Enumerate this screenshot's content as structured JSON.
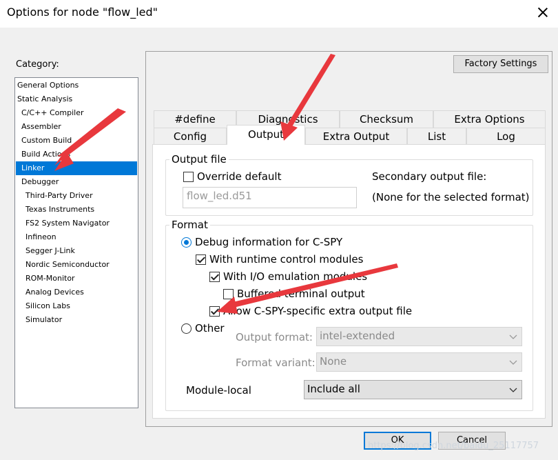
{
  "window": {
    "title": "Options for node \"flow_led\"",
    "close_icon": "close-icon"
  },
  "category": {
    "label": "Category:",
    "items": [
      "General Options",
      "Static Analysis",
      "C/C++ Compiler",
      "Assembler",
      "Custom Build",
      "Build Actions",
      "Linker",
      "Debugger",
      "Third-Party Driver",
      "Texas Instruments",
      "FS2 System Navigator",
      "Infineon",
      "Segger J-Link",
      "Nordic Semiconductor",
      "ROM-Monitor",
      "Analog Devices",
      "Silicon Labs",
      "Simulator"
    ],
    "selected": "Linker"
  },
  "factory_settings_label": "Factory Settings",
  "tabs": {
    "row1": [
      "#define",
      "Diagnostics",
      "Checksum",
      "Extra Options"
    ],
    "row2": [
      "Config",
      "Output",
      "Extra Output",
      "List",
      "Log"
    ],
    "active": "Output"
  },
  "output_file": {
    "group_title": "Output file",
    "override_label": "Override default",
    "override_checked": false,
    "filename_value": "flow_led.d51",
    "secondary_label": "Secondary output file:",
    "secondary_value": "(None for the selected format)"
  },
  "format": {
    "group_title": "Format",
    "debug_label": "Debug information for C-SPY",
    "debug_selected": true,
    "runtime_label": "With runtime control modules",
    "runtime_checked": true,
    "io_label": "With I/O emulation modules",
    "io_checked": true,
    "buffered_label": "Buffered terminal output",
    "buffered_checked": false,
    "allow_label": "Allow C-SPY-specific extra output file",
    "allow_checked": true,
    "other_label": "Other",
    "other_selected": false,
    "output_format_label": "Output format:",
    "output_format_value": "intel-extended",
    "format_variant_label": "Format variant:",
    "format_variant_value": "None",
    "module_local_label": "Module-local",
    "module_local_value": "Include all"
  },
  "buttons": {
    "ok": "OK",
    "cancel": "Cancel"
  },
  "annotation_color": "#e8383d",
  "watermark": "https://blog.csdn.net/baidu_25117757"
}
